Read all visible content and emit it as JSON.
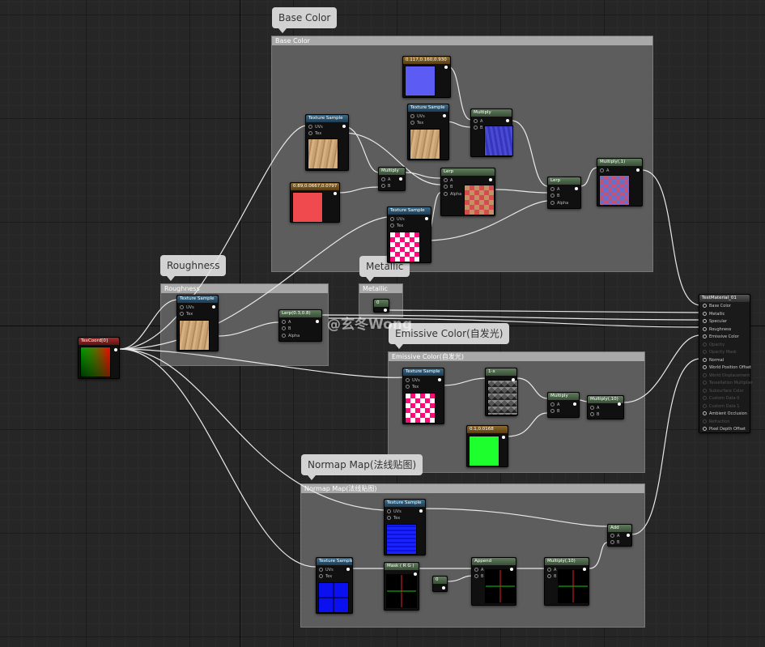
{
  "comments": {
    "base_color": {
      "bubble": "Base Color",
      "header": "Base Color"
    },
    "roughness": {
      "bubble": "Roughness",
      "header": "Roughness"
    },
    "metallic": {
      "bubble": "Metallic",
      "header": "Metallic"
    },
    "emissive": {
      "bubble": "Emissive Color(自发光)",
      "header": "Emissive Color(自发光)"
    },
    "normal": {
      "bubble": "Normap Map(法线贴图)",
      "header": "Normap Map(法线贴图)"
    }
  },
  "nodes": {
    "texcoord": {
      "title": "TexCoord[0]"
    },
    "texture_sample": {
      "title": "Texture Sample",
      "uvs": "UVs",
      "tex": "Tex"
    },
    "color_blue": {
      "title": "0.117,0.160,0.930"
    },
    "color_red": {
      "title": "0.89,0.0667,0.0797"
    },
    "multiply": {
      "title": "Multiply",
      "a": "A",
      "b": "B"
    },
    "multiply_1": {
      "title": "Multiply(,1)"
    },
    "multiply_10": {
      "title": "Multiply(,10)"
    },
    "lerp": {
      "title": "Lerp",
      "alpha": "Alpha"
    },
    "lerp_roughness": {
      "title": "Lerp(0.3,0.8)"
    },
    "metallic_const": {
      "title": "0"
    },
    "one_minus": {
      "title": "1-x"
    },
    "emissive_const": {
      "title": "0.1,0.0168"
    },
    "mask": {
      "title": "Mask ( R G )"
    },
    "normal_const": {
      "title": "0"
    },
    "append": {
      "title": "Append"
    },
    "add": {
      "title": "Add"
    }
  },
  "output": {
    "title": "TestMaterial_01",
    "pins": [
      {
        "label": "Base Color",
        "active": true
      },
      {
        "label": "Metallic",
        "active": true
      },
      {
        "label": "Specular",
        "active": true
      },
      {
        "label": "Roughness",
        "active": true
      },
      {
        "label": "Emissive Color",
        "active": true
      },
      {
        "label": "Opacity",
        "active": false
      },
      {
        "label": "Opacity Mask",
        "active": false
      },
      {
        "label": "Normal",
        "active": true
      },
      {
        "label": "World Position Offset",
        "active": true
      },
      {
        "label": "World Displacement",
        "active": false
      },
      {
        "label": "Tessellation Multiplier",
        "active": false
      },
      {
        "label": "Subsurface Color",
        "active": false
      },
      {
        "label": "Custom Data 0",
        "active": false
      },
      {
        "label": "Custom Data 1",
        "active": false
      },
      {
        "label": "Ambient Occlusion",
        "active": true
      },
      {
        "label": "Refraction",
        "active": false
      },
      {
        "label": "Pixel Depth Offset",
        "active": true
      }
    ]
  },
  "watermark": "@玄冬Wong"
}
